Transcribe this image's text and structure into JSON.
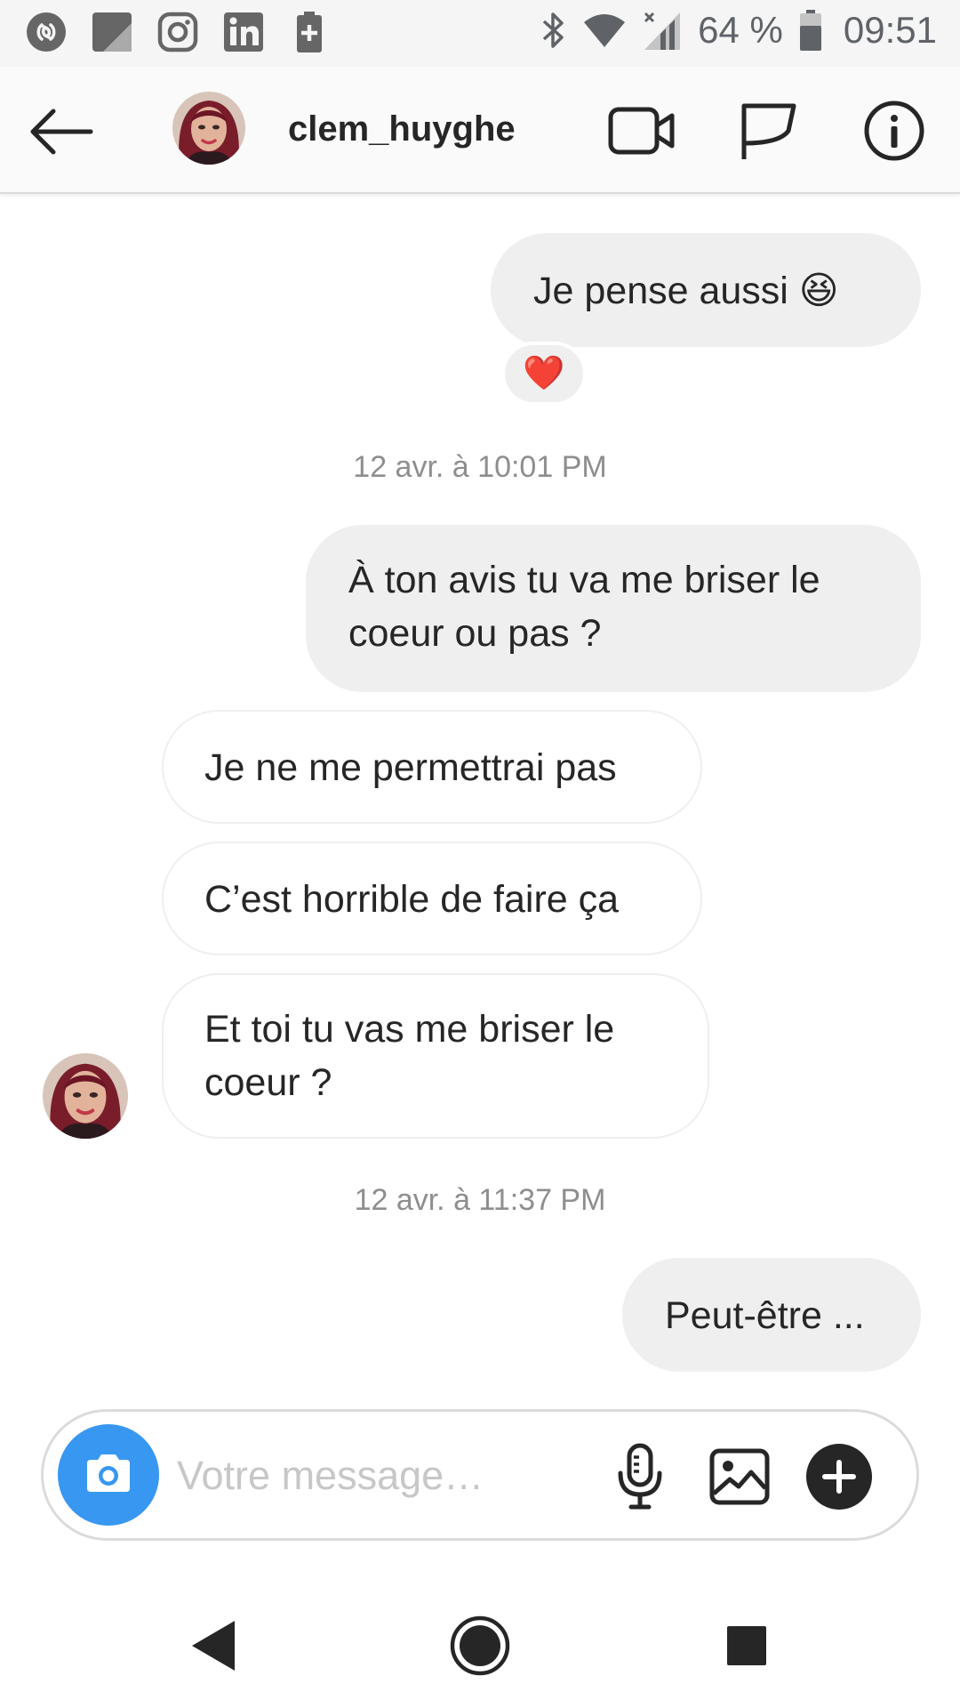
{
  "status_bar": {
    "left_icons": [
      "shazam-icon",
      "tile-icon",
      "instagram-icon",
      "linkedin-icon",
      "battery-saver-icon"
    ],
    "right_icons": [
      "bluetooth-icon",
      "wifi-icon",
      "cellular-no-signal-icon",
      "battery-icon"
    ],
    "battery": "64 %",
    "time": "09:51"
  },
  "header": {
    "username": "clem_huyghe",
    "icons": [
      "back-arrow-icon",
      "avatar",
      "video-call-icon",
      "flag-icon",
      "info-icon"
    ]
  },
  "messages": [
    {
      "id": "m1",
      "direction": "outgoing",
      "text": "Je pense aussi 😆",
      "reaction": "❤️"
    },
    {
      "id": "t1",
      "type": "timestamp",
      "text": "12 avr. à 10:01 PM"
    },
    {
      "id": "m2",
      "direction": "outgoing",
      "text": "À ton avis tu va me briser le coeur ou pas ?"
    },
    {
      "id": "m3",
      "direction": "incoming",
      "text": "Je ne me permettrai pas"
    },
    {
      "id": "m4",
      "direction": "incoming",
      "text": "C’est horrible de faire ça"
    },
    {
      "id": "m5",
      "direction": "incoming",
      "text": "Et toi tu vas me briser le coeur ?"
    },
    {
      "id": "t2",
      "type": "timestamp",
      "text": "12 avr. à 11:37 PM"
    },
    {
      "id": "m6",
      "direction": "outgoing",
      "text": "Peut-être ..."
    }
  ],
  "composer": {
    "placeholder": "Votre message…",
    "value": "",
    "icons": [
      "camera-icon",
      "microphone-icon",
      "gallery-icon",
      "plus-icon"
    ]
  },
  "nav_bar": {
    "icons": [
      "back-triangle-icon",
      "home-circle-icon",
      "recents-square-icon"
    ]
  },
  "colors": {
    "outgoing_bubble": "#efefef",
    "incoming_border": "#efefef",
    "camera_button": "#3897f0",
    "timestamp_text": "#8e8e8e",
    "heart": "#e0202b"
  }
}
